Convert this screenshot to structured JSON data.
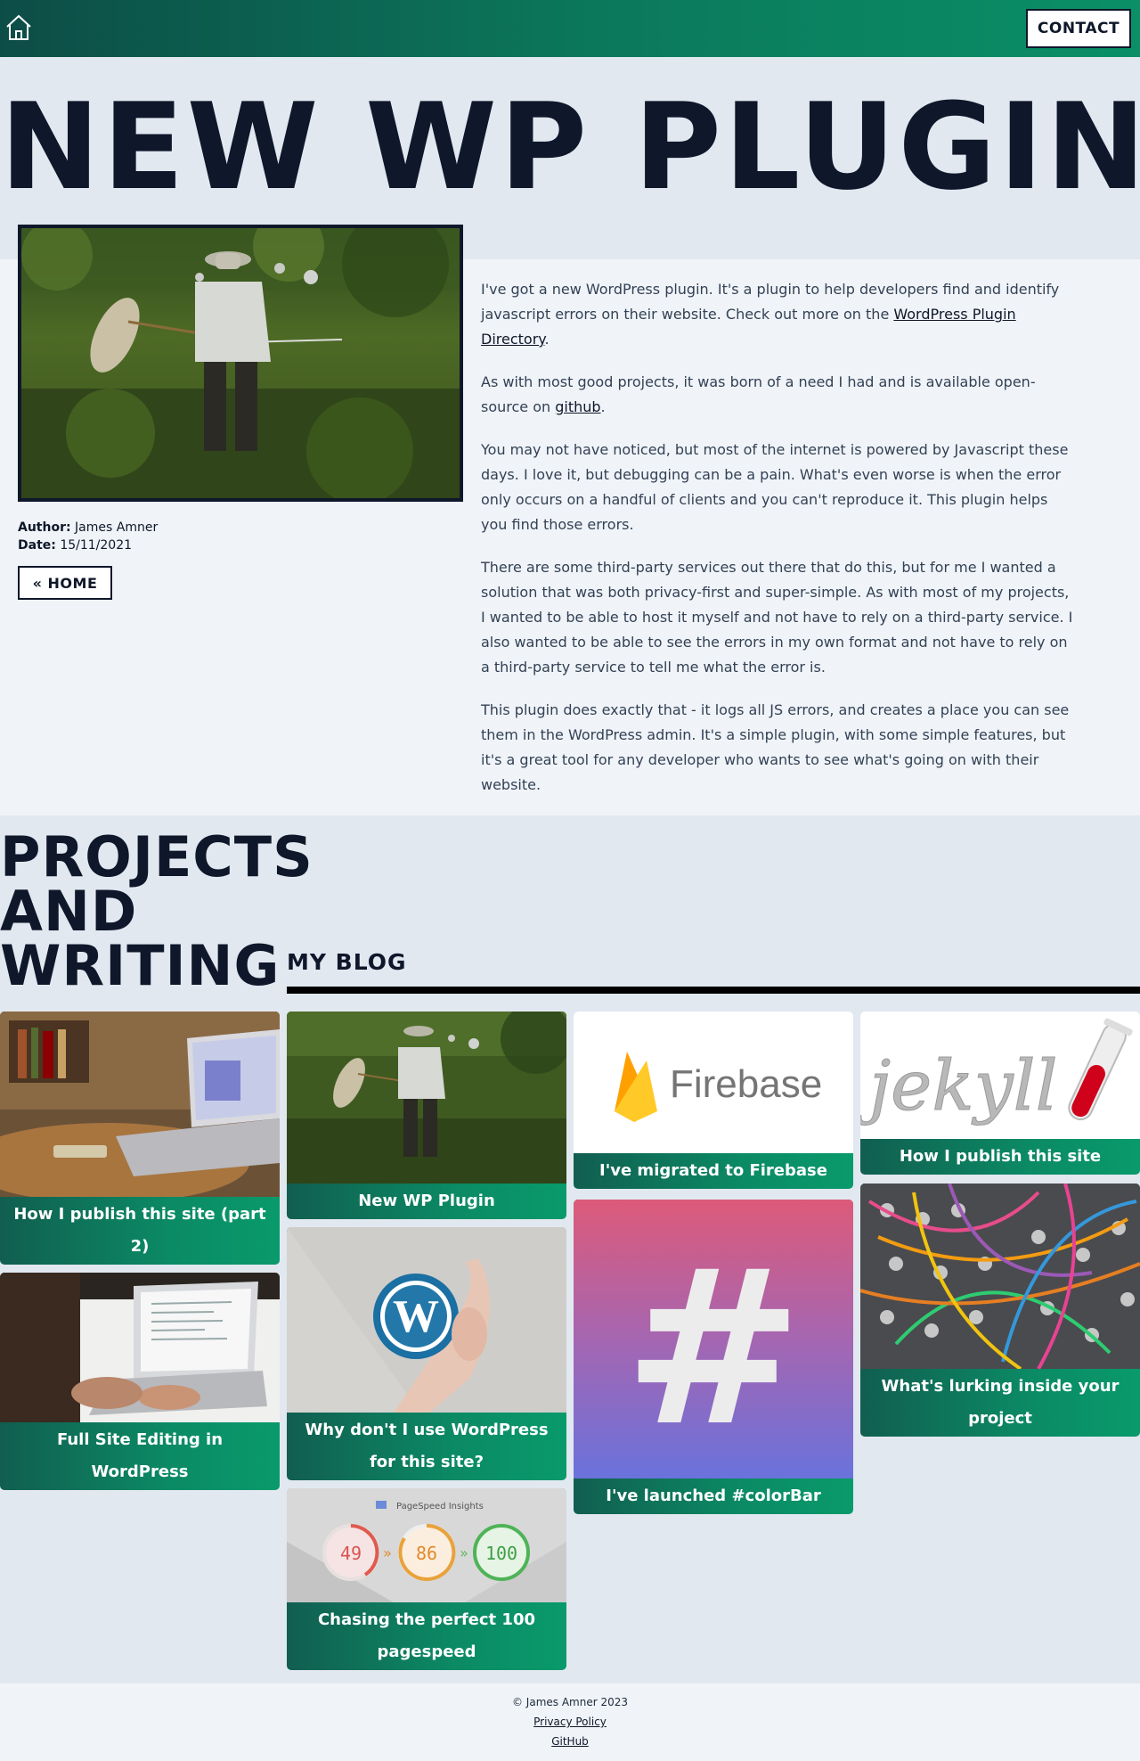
{
  "header": {
    "contact_label": "CONTACT"
  },
  "hero": {
    "title": "NEW WP PLUGIN"
  },
  "article": {
    "author_label": "Author:",
    "author": "James Amner",
    "date_label": "Date:",
    "date": "15/11/2021",
    "home_button": "« HOME",
    "p1_before": "I've got a new WordPress plugin. It's a plugin to help developers find and identify javascript errors on their website. Check out more on the ",
    "p1_link": "WordPress Plugin Directory",
    "p1_after": ".",
    "p2_before": "As with most good projects, it was born of a need I had and is available open-source on ",
    "p2_link": "github",
    "p2_after": ".",
    "p3": "You may not have noticed, but most of the internet is powered by Javascript these days. I love it, but debugging can be a pain. What's even worse is when the error only occurs on a handful of clients and you can't reproduce it. This plugin helps you find those errors.",
    "p4": "There are some third-party services out there that do this, but for me I wanted a solution that was both privacy-first and super-simple. As with most of my projects, I wanted to be able to host it myself and not have to rely on a third-party service. I also wanted to be able to see the errors in my own format and not have to rely on a third-party service to tell me what the error is.",
    "p5": "This plugin does exactly that - it logs all JS errors, and creates a place you can see them in the WordPress admin. It's a simple plugin, with some simple features, but it's a great tool for any developer who wants to see what's going on with their website."
  },
  "projects": {
    "title_line1": "PROJECTS",
    "title_line2": "AND",
    "title_line3": "WRITING",
    "blog_heading": "MY BLOG",
    "cards": [
      {
        "title": "How I publish this site (part 2)"
      },
      {
        "title": "Full Site Editing in WordPress"
      },
      {
        "title": "New WP Plugin"
      },
      {
        "title": "Why don't I use WordPress for this site?"
      },
      {
        "title": "Chasing the perfect 100 pagespeed"
      },
      {
        "title": "I've migrated to Firebase"
      },
      {
        "title": "I've launched #colorBar"
      },
      {
        "title": "How I publish this site"
      },
      {
        "title": "What's lurking inside your project"
      }
    ],
    "thumb_text": {
      "firebase": "Firebase",
      "jekyll": "jekyll",
      "hash": "#",
      "pagespeed_header": "PageSpeed Insights",
      "score1": "49",
      "score2": "86",
      "score3": "100",
      "arrow": "»"
    }
  },
  "footer": {
    "copyright": "© James Amner 2023",
    "privacy": "Privacy Policy",
    "github": "GitHub"
  },
  "colors": {
    "accent_green": "#0b8a64",
    "dark_navy": "#0f172a",
    "band_gray": "#e2e8f0"
  }
}
